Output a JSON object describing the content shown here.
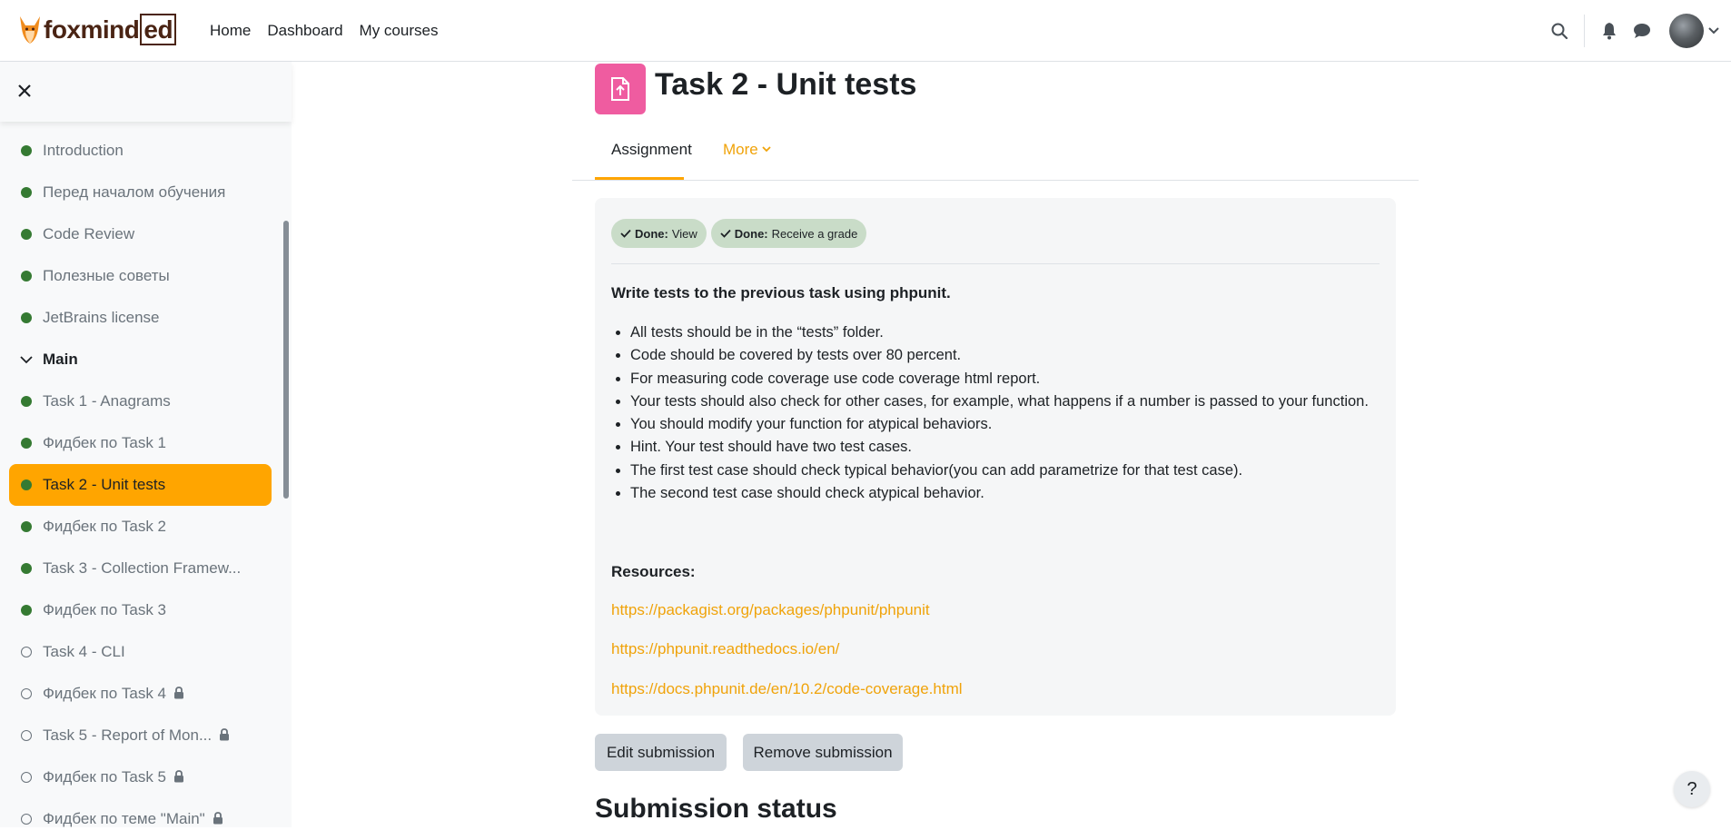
{
  "brand": {
    "logo_text_start": "foxmind",
    "logo_text_box": "ed"
  },
  "nav": {
    "links": [
      "Home",
      "Dashboard",
      "My courses"
    ]
  },
  "icons": {
    "search": "search-icon",
    "notifications": "bell-icon",
    "messages": "chat-icon",
    "user_menu": "chevron-down-icon",
    "close": "close-icon",
    "help": "question-icon"
  },
  "drawer": {
    "close_label": "✕",
    "items": [
      {
        "label": "Introduction",
        "status": "done"
      },
      {
        "label": "Перед началом обучения",
        "status": "done"
      },
      {
        "label": "Code Review",
        "status": "done"
      },
      {
        "label": "Полезные советы",
        "status": "done"
      },
      {
        "label": "JetBrains license",
        "status": "done"
      },
      {
        "label": "Main",
        "status": "section"
      },
      {
        "label": "Task 1 - Anagrams",
        "status": "done"
      },
      {
        "label": "Фидбек по Task 1",
        "status": "done"
      },
      {
        "label": "Task 2 - Unit tests",
        "status": "done",
        "active": true
      },
      {
        "label": "Фидбек по Task 2",
        "status": "done"
      },
      {
        "label": "Task 3 - Collection Framew...",
        "status": "done"
      },
      {
        "label": "Фидбек по Task 3",
        "status": "done"
      },
      {
        "label": "Task 4 - CLI",
        "status": "todo"
      },
      {
        "label": "Фидбек по Task 4",
        "status": "todo",
        "locked": true
      },
      {
        "label": "Task 5 - Report of Mon...",
        "status": "todo",
        "locked": true
      },
      {
        "label": "Фидбек по Task 5",
        "status": "todo",
        "locked": true
      },
      {
        "label": "Фидбек по теме \"Main\"",
        "status": "todo",
        "locked": true
      }
    ]
  },
  "page": {
    "title": "Task 2 - Unit tests",
    "activity_icon": "assignment-upload-icon",
    "tabs": {
      "assignment": "Assignment",
      "more": "More"
    }
  },
  "completion": [
    {
      "status": "Done:",
      "text": "View"
    },
    {
      "status": "Done:",
      "text": "Receive a grade"
    }
  ],
  "description": {
    "intro": "Write tests to the previous task using phpunit.",
    "bullets": [
      "All tests should be in the “tests” folder.",
      "Code should be covered by tests over 80 percent.",
      "For measuring code coverage use code coverage html report.",
      "Your tests should also check for other cases, for example, what happens if a number is passed to your function.",
      "You should modify your function for atypical behaviors.",
      "Hint. Your test should have two test cases.",
      "The first test case should check typical behavior(you can add parametrize for that test case).",
      "The second test case should check atypical behavior."
    ],
    "resources_label": "Resources:",
    "links": [
      "https://packagist.org/packages/phpunit/phpunit",
      "https://phpunit.readthedocs.io/en/",
      "https://docs.phpunit.de/en/10.2/code-coverage.html"
    ]
  },
  "actions": {
    "edit": "Edit submission",
    "remove": "Remove submission"
  },
  "submission_status_heading": "Submission status",
  "help_label": "?",
  "colors": {
    "accent": "#ffa500",
    "link": "#f0a30a",
    "done": "#357a32",
    "activity_icon_bg": "#ef5ca0",
    "badge_bg": "#c9dcc8"
  }
}
